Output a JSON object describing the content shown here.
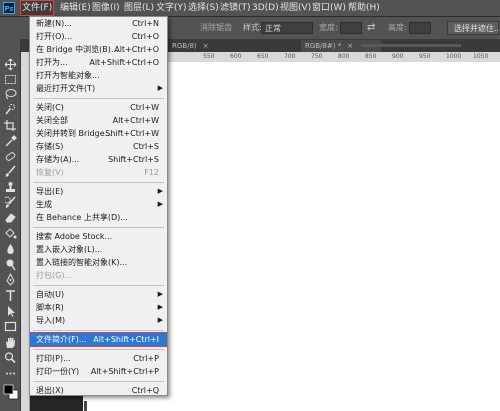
{
  "menubar": {
    "items": [
      "文件(F)",
      "编辑(E)",
      "图像(I)",
      "图层(L)",
      "文字(Y)",
      "选择(S)",
      "滤镜(T)",
      "3D(D)",
      "视图(V)",
      "窗口(W)",
      "帮助(H)"
    ],
    "active_index": 0,
    "logo_text": "Ps"
  },
  "options_bar": {
    "feather_label": "消除锯齿",
    "style_label": "样式:",
    "style_value": "正常",
    "width_label": "宽度:",
    "height_label": "高度:",
    "select_mask_button": "选择并遮住...",
    "swap_glyph": "⇄"
  },
  "document_tabs": [
    {
      "label": "RGB/8)",
      "close": "×"
    },
    {
      "label": "RGB/8#) *",
      "close": "×"
    }
  ],
  "ruler": {
    "labels": [
      "550",
      "600",
      "650",
      "700",
      "750",
      "800",
      "850",
      "900",
      "950",
      "1000",
      "1050"
    ]
  },
  "file_menu": {
    "items": [
      {
        "label": "新建(N)...",
        "shortcut": "Ctrl+N"
      },
      {
        "label": "打开(O)...",
        "shortcut": "Ctrl+O"
      },
      {
        "label": "在 Bridge 中浏览(B)...",
        "shortcut": "Alt+Ctrl+O"
      },
      {
        "label": "打开为...",
        "shortcut": "Alt+Shift+Ctrl+O"
      },
      {
        "label": "打开为智能对象...",
        "shortcut": ""
      },
      {
        "label": "最近打开文件(T)",
        "shortcut": "",
        "submenu": true
      },
      {
        "separator": true
      },
      {
        "label": "关闭(C)",
        "shortcut": "Ctrl+W"
      },
      {
        "label": "关闭全部",
        "shortcut": "Alt+Ctrl+W"
      },
      {
        "label": "关闭并转到 Bridge...",
        "shortcut": "Shift+Ctrl+W"
      },
      {
        "label": "存储(S)",
        "shortcut": "Ctrl+S"
      },
      {
        "label": "存储为(A)...",
        "shortcut": "Shift+Ctrl+S"
      },
      {
        "label": "恢复(V)",
        "shortcut": "F12",
        "disabled": true
      },
      {
        "separator": true
      },
      {
        "label": "导出(E)",
        "shortcut": "",
        "submenu": true
      },
      {
        "label": "生成",
        "shortcut": "",
        "submenu": true
      },
      {
        "label": "在 Behance 上共享(D)...",
        "shortcut": ""
      },
      {
        "separator": true
      },
      {
        "label": "搜索 Adobe Stock...",
        "shortcut": ""
      },
      {
        "label": "置入嵌入对象(L)...",
        "shortcut": ""
      },
      {
        "label": "置入链接的智能对象(K)...",
        "shortcut": ""
      },
      {
        "label": "打包(G)...",
        "shortcut": "",
        "disabled": true
      },
      {
        "separator": true
      },
      {
        "label": "自动(U)",
        "shortcut": "",
        "submenu": true
      },
      {
        "label": "脚本(R)",
        "shortcut": "",
        "submenu": true
      },
      {
        "label": "导入(M)",
        "shortcut": "",
        "submenu": true
      },
      {
        "separator": true
      },
      {
        "label": "文件简介(F)...",
        "shortcut": "Alt+Shift+Ctrl+I",
        "highlighted": true
      },
      {
        "separator": true
      },
      {
        "label": "打印(P)...",
        "shortcut": "Ctrl+P"
      },
      {
        "label": "打印一份(Y)",
        "shortcut": "Alt+Shift+Ctrl+P"
      },
      {
        "separator": true
      },
      {
        "label": "退出(X)",
        "shortcut": "Ctrl+Q"
      }
    ]
  },
  "toolbar": {
    "tools": [
      "move-tool",
      "marquee-tool",
      "lasso-tool",
      "quick-select-tool",
      "crop-tool",
      "eyedropper-tool",
      "healing-brush-tool",
      "brush-tool",
      "clone-stamp-tool",
      "history-brush-tool",
      "eraser-tool",
      "paint-bucket-tool",
      "blur-tool",
      "dodge-tool",
      "pen-tool",
      "type-tool",
      "path-select-tool",
      "rectangle-tool",
      "hand-tool",
      "zoom-tool",
      "more-tools",
      "color-swatches"
    ]
  },
  "colors": {
    "ui_dark": "#535353",
    "menu_bg": "#f0f0f0",
    "highlight": "#2a7ad5",
    "annotation_red": "#e83a3a"
  }
}
